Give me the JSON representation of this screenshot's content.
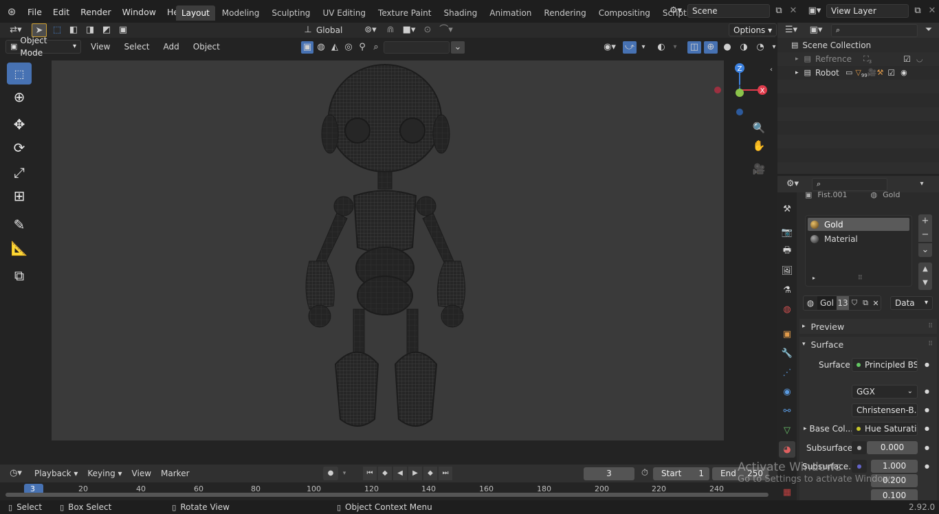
{
  "menu": [
    "File",
    "Edit",
    "Render",
    "Window",
    "Help"
  ],
  "workspaces": [
    "Layout",
    "Modeling",
    "Sculpting",
    "UV Editing",
    "Texture Paint",
    "Shading",
    "Animation",
    "Rendering",
    "Compositing",
    "Scripting"
  ],
  "active_workspace": "Layout",
  "scene": "Scene",
  "view_layer": "View Layer",
  "toolheader": {
    "transform_orientation": "Global",
    "options": "Options"
  },
  "viewport_header": {
    "mode": "Object Mode",
    "menus": [
      "View",
      "Select",
      "Add",
      "Object"
    ]
  },
  "gizmo": {
    "z": "Z",
    "y": "Y",
    "x": "X"
  },
  "outliner": {
    "root": "Scene Collection",
    "items": [
      {
        "name": "Refrence",
        "count": "3"
      },
      {
        "name": "Robot",
        "count": "99"
      }
    ]
  },
  "properties": {
    "top_object": "Fist.001",
    "top_material": "Gold",
    "slots": [
      "Gold",
      "Material"
    ],
    "datablock": {
      "name": "Gol",
      "users": "13",
      "link": "Data"
    },
    "panels": {
      "preview": "Preview",
      "surface": "Surface"
    },
    "rows": {
      "surface_label": "Surface",
      "surface_value": "Principled BS...",
      "distribution": "GGX",
      "subsurface_method": "Christensen-B...",
      "base_color_label": "Base Col...",
      "base_color_value": "Hue Saturati...",
      "subsurface_label": "Subsurface",
      "subsurface_value": "0.000",
      "subsurface2_label": "Subsurface...",
      "subsurface2_value": "1.000",
      "v3": "0.200",
      "v4": "0.100"
    }
  },
  "timeline": {
    "menus": [
      "Playback",
      "Keying",
      "View",
      "Marker"
    ],
    "current_frame": "3",
    "start_label": "Start",
    "start": "1",
    "end_label": "End",
    "end": "250",
    "ruler": [
      "3",
      "20",
      "40",
      "60",
      "80",
      "100",
      "120",
      "140",
      "160",
      "180",
      "200",
      "220",
      "240"
    ]
  },
  "statusbar": {
    "select": "Select",
    "box_select": "Box Select",
    "rotate_view": "Rotate View",
    "context_menu": "Object Context Menu",
    "version": "2.92.0"
  },
  "watermark": {
    "line1": "Activate Windows",
    "line2": "Go to Settings to activate Windows."
  },
  "colors": {
    "accent": "#4772b3",
    "active_tool": "#4772b3",
    "x_axis": "#e03c4c",
    "y_axis": "#8bc34a",
    "z_axis": "#3d82e0"
  }
}
